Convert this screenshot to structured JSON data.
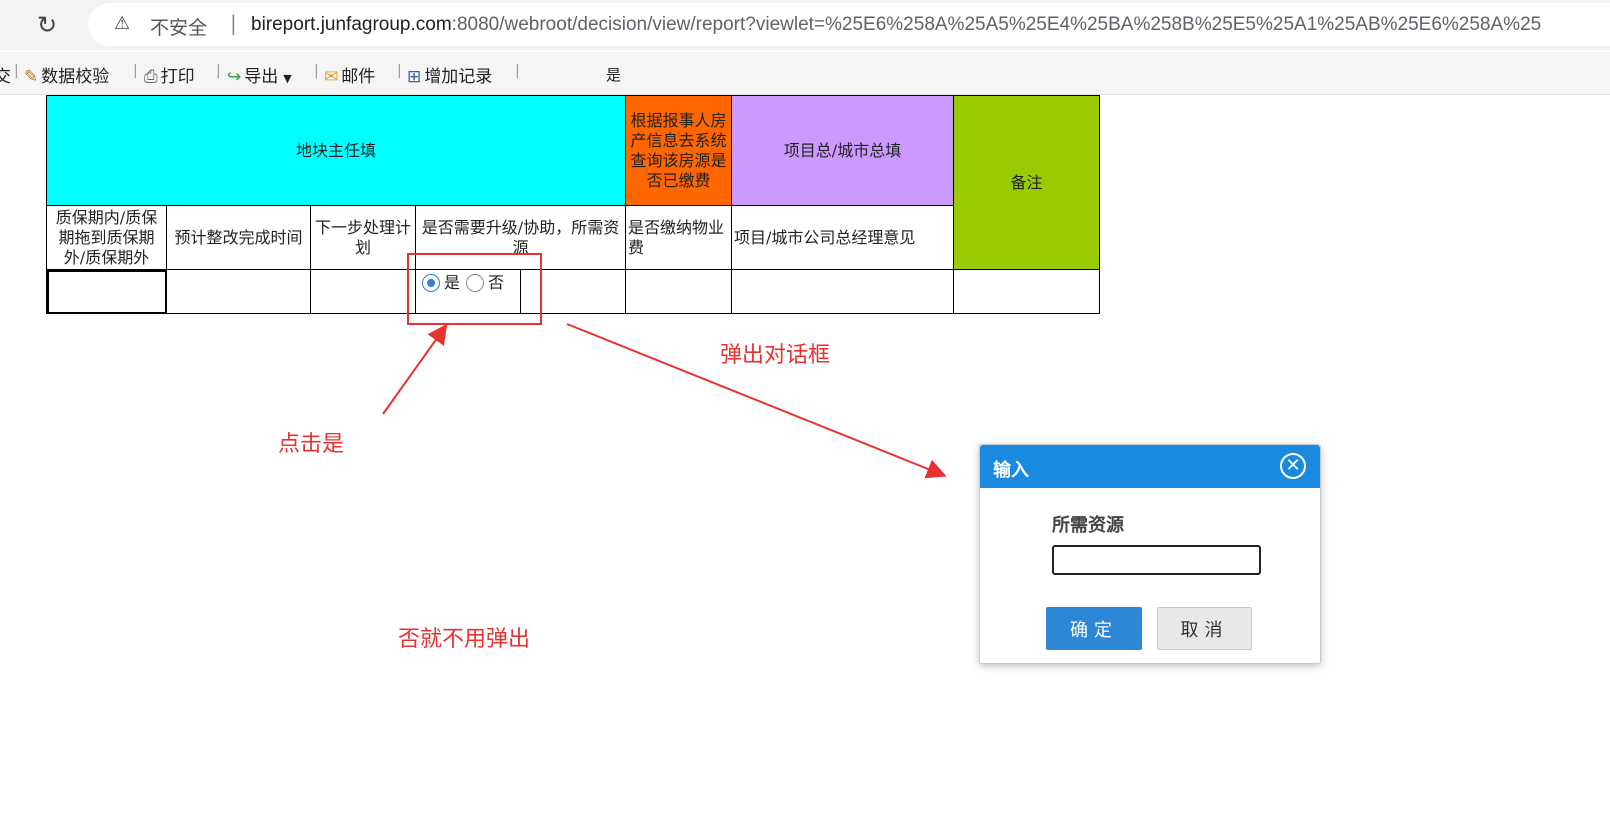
{
  "browser": {
    "security_label": "不安全",
    "url_host": "bireport.junfagroup.com",
    "url_rest": ":8080/webroot/decision/view/report?viewlet=%25E6%258A%25A5%25E4%25BA%258B%25E5%25A1%25AB%25E6%258A%25"
  },
  "toolbar": {
    "truncated_left": "交",
    "data_check": "数据校验",
    "print": "打印",
    "export": "导出",
    "mail": "邮件",
    "add_record": "增加记录",
    "status_text": "是"
  },
  "table": {
    "group_headers": {
      "plot_manager": "地块主任填",
      "fee_check": "根据报事人房产信息去系统查询该房源是否已缴费",
      "project_city": "项目总/城市总填",
      "remarks": "备注"
    },
    "columns": {
      "warranty": "质保期内/质保期拖到质保期外/质保期外",
      "est_time": "预计整改完成时间",
      "next_plan": "下一步处理计划",
      "need_upgrade": "是否需要升级/协助，所需资源",
      "fee_paid": "是否缴纳物业费",
      "gm_opinion": "项目/城市公司总经理意见"
    },
    "radio": {
      "yes": "是",
      "no": "否",
      "selected": "yes"
    }
  },
  "annotations": {
    "click_yes": "点击是",
    "popup_dialog": "弹出对话框",
    "no_popup": "否就不用弹出"
  },
  "dialog": {
    "title": "输入",
    "field_label": "所需资源",
    "input_value": "",
    "ok_label": "确定",
    "cancel_label": "取消"
  },
  "colors": {
    "cyan": "#00ffff",
    "orange": "#ff6600",
    "purple": "#cc99ff",
    "green": "#99cc00",
    "annotation_red": "#e83232",
    "dialog_blue": "#1a8ae0",
    "ok_button": "#2d86d6"
  }
}
